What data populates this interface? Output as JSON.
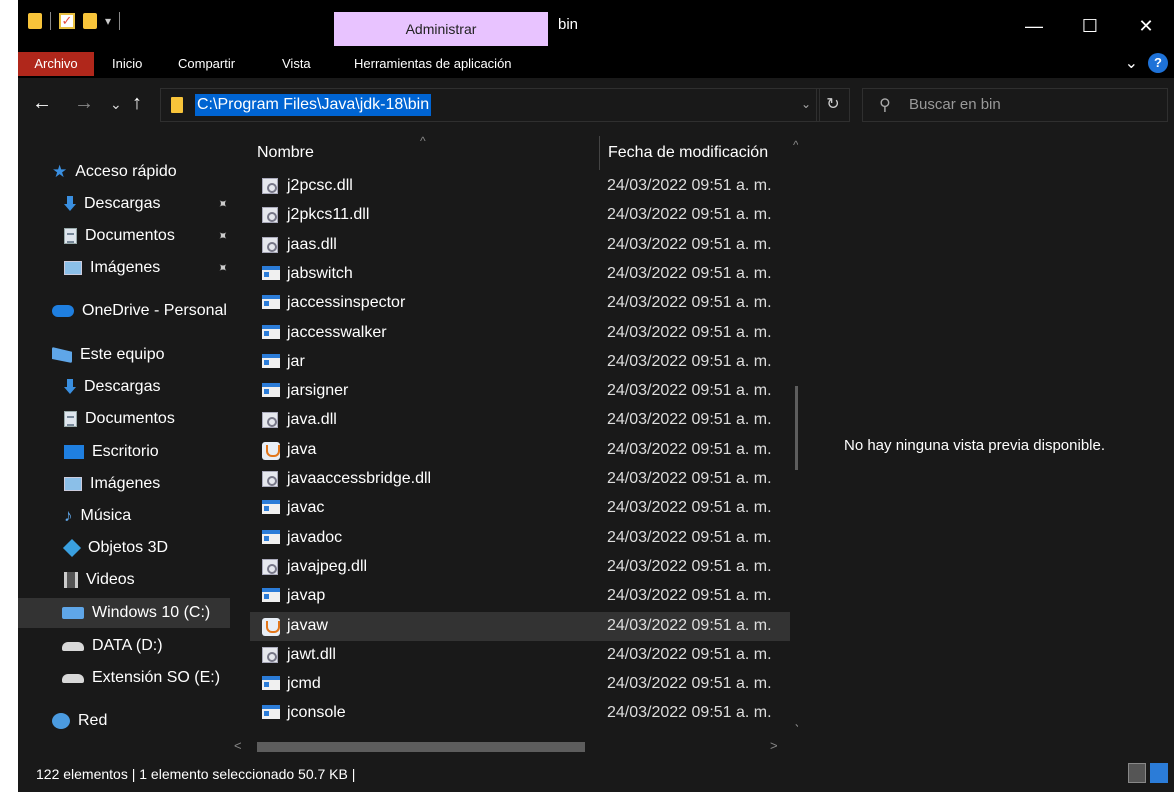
{
  "window": {
    "title": "bin",
    "context_tab": "Administrar",
    "controls": {
      "minimize": "—",
      "maximize": "☐",
      "close": "✕"
    }
  },
  "ribbon": {
    "tabs": [
      "Archivo",
      "Inicio",
      "Compartir",
      "Vista",
      "Herramientas de aplicación"
    ],
    "collapse": "⌄",
    "help": "?"
  },
  "nav": {
    "back": "←",
    "forward": "→",
    "recent": "⌄",
    "up": "↑",
    "address": "C:\\Program Files\\Java\\jdk-18\\bin",
    "address_dropdown": "⌄",
    "refresh": "↻",
    "search_placeholder": "Buscar en bin",
    "search_icon": "⚲"
  },
  "sidebar": {
    "items": [
      {
        "label": "Acceso rápido",
        "icon": "star-icon"
      },
      {
        "label": "Descargas",
        "icon": "download-icon",
        "pinned": true
      },
      {
        "label": "Documentos",
        "icon": "document-icon",
        "pinned": true
      },
      {
        "label": "Imágenes",
        "icon": "pictures-icon",
        "pinned": true
      },
      {
        "label": "OneDrive - Personal",
        "icon": "cloud-icon"
      },
      {
        "label": "Este equipo",
        "icon": "computer-icon"
      },
      {
        "label": "Descargas",
        "icon": "download-icon"
      },
      {
        "label": "Documentos",
        "icon": "document-icon"
      },
      {
        "label": "Escritorio",
        "icon": "desktop-icon"
      },
      {
        "label": "Imágenes",
        "icon": "pictures-icon"
      },
      {
        "label": "Música",
        "icon": "music-icon"
      },
      {
        "label": "Objetos 3D",
        "icon": "3d-objects-icon"
      },
      {
        "label": "Videos",
        "icon": "videos-icon"
      },
      {
        "label": "Windows 10 (C:)",
        "icon": "windows-drive-icon",
        "selected": true
      },
      {
        "label": "DATA (D:)",
        "icon": "drive-icon"
      },
      {
        "label": "Extensión SO (E:)",
        "icon": "drive-icon"
      },
      {
        "label": "Red",
        "icon": "network-icon"
      }
    ],
    "pin_glyph": "📌"
  },
  "list": {
    "columns": {
      "name": "Nombre",
      "date": "Fecha de modificación"
    },
    "sort_glyph": "^",
    "files": [
      {
        "name": "j2pcsc.dll",
        "date": "24/03/2022 09:51 a. m.",
        "type": "dll"
      },
      {
        "name": "j2pkcs11.dll",
        "date": "24/03/2022 09:51 a. m.",
        "type": "dll"
      },
      {
        "name": "jaas.dll",
        "date": "24/03/2022 09:51 a. m.",
        "type": "dll"
      },
      {
        "name": "jabswitch",
        "date": "24/03/2022 09:51 a. m.",
        "type": "exe"
      },
      {
        "name": "jaccessinspector",
        "date": "24/03/2022 09:51 a. m.",
        "type": "exe"
      },
      {
        "name": "jaccesswalker",
        "date": "24/03/2022 09:51 a. m.",
        "type": "exe"
      },
      {
        "name": "jar",
        "date": "24/03/2022 09:51 a. m.",
        "type": "exe"
      },
      {
        "name": "jarsigner",
        "date": "24/03/2022 09:51 a. m.",
        "type": "exe"
      },
      {
        "name": "java.dll",
        "date": "24/03/2022 09:51 a. m.",
        "type": "dll"
      },
      {
        "name": "java",
        "date": "24/03/2022 09:51 a. m.",
        "type": "java"
      },
      {
        "name": "javaaccessbridge.dll",
        "date": "24/03/2022 09:51 a. m.",
        "type": "dll"
      },
      {
        "name": "javac",
        "date": "24/03/2022 09:51 a. m.",
        "type": "exe"
      },
      {
        "name": "javadoc",
        "date": "24/03/2022 09:51 a. m.",
        "type": "exe"
      },
      {
        "name": "javajpeg.dll",
        "date": "24/03/2022 09:51 a. m.",
        "type": "dll"
      },
      {
        "name": "javap",
        "date": "24/03/2022 09:51 a. m.",
        "type": "exe"
      },
      {
        "name": "javaw",
        "date": "24/03/2022 09:51 a. m.",
        "type": "java",
        "selected": true
      },
      {
        "name": "jawt.dll",
        "date": "24/03/2022 09:51 a. m.",
        "type": "dll"
      },
      {
        "name": "jcmd",
        "date": "24/03/2022 09:51 a. m.",
        "type": "exe"
      },
      {
        "name": "jconsole",
        "date": "24/03/2022 09:51 a. m.",
        "type": "exe"
      }
    ],
    "scroll": {
      "up": "^",
      "down": "⌄",
      "left": "<",
      "right": ">"
    }
  },
  "preview": {
    "message": "No hay ninguna vista previa disponible."
  },
  "status": {
    "text": "122 elementos  |  1 elemento seleccionado  50.7 KB  |"
  }
}
